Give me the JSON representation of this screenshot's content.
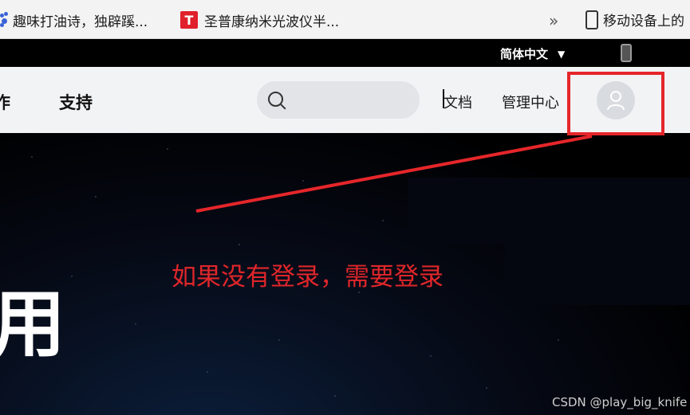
{
  "bookmarks": {
    "items": [
      {
        "label": "趣味打油诗，独辟蹊...",
        "icon": "paw-icon"
      },
      {
        "label": "圣普康纳米光波仪半...",
        "icon": "t-logo-icon",
        "icon_text": "T"
      }
    ],
    "more_label": "»",
    "mobile_label": "移动设备上的"
  },
  "topbar": {
    "language": "简体中文",
    "language_caret": "▼"
  },
  "nav": {
    "partial_item": "作",
    "support": "支持",
    "search_placeholder": "",
    "docs": "文档",
    "management": "管理中心"
  },
  "hero": {
    "title_partial": "用"
  },
  "annotation": {
    "text": "如果没有登录，需要登录",
    "color": "#e5262a"
  },
  "watermark": "CSDN @play_big_knife",
  "colors": {
    "nav_bg": "#f2f3f5",
    "topbar_bg": "#000000",
    "avatar_bg": "#d8dbe0",
    "annotation_red": "#e5262a"
  }
}
